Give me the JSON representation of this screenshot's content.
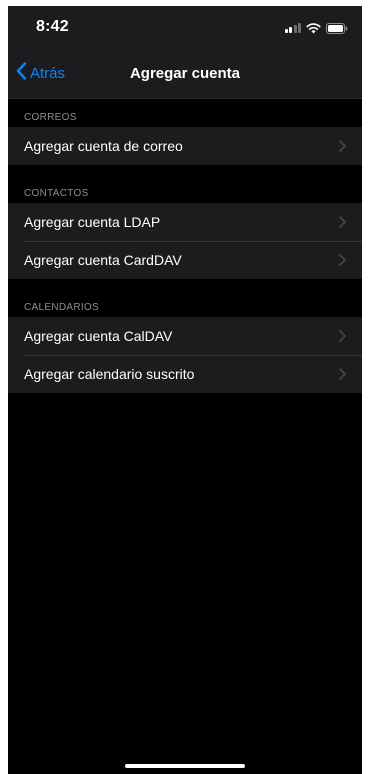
{
  "status_bar": {
    "time": "8:42",
    "icons": [
      "signal-icon",
      "wifi-icon",
      "battery-icon"
    ]
  },
  "nav": {
    "back_label": "Atrás",
    "title": "Agregar cuenta"
  },
  "sections": [
    {
      "header": "CORREOS",
      "items": [
        {
          "label": "Agregar cuenta de correo"
        }
      ]
    },
    {
      "header": "CONTACTOS",
      "items": [
        {
          "label": "Agregar cuenta LDAP"
        },
        {
          "label": "Agregar cuenta CardDAV"
        }
      ]
    },
    {
      "header": "CALENDARIOS",
      "items": [
        {
          "label": "Agregar cuenta CalDAV"
        },
        {
          "label": "Agregar calendario suscrito"
        }
      ]
    }
  ],
  "colors": {
    "background": "#000000",
    "cell": "#1c1c1e",
    "accent": "#0a84ff",
    "secondary_text": "#8e8e93"
  }
}
